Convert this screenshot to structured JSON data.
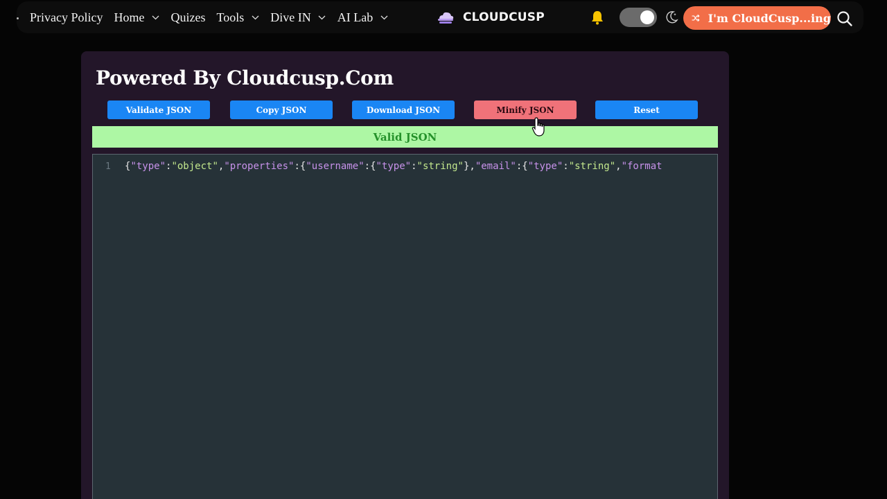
{
  "nav": {
    "items": [
      {
        "label": "Privacy Policy",
        "has_dropdown": false
      },
      {
        "label": "Home",
        "has_dropdown": true
      },
      {
        "label": "Quizes",
        "has_dropdown": false
      },
      {
        "label": "Tools",
        "has_dropdown": true
      },
      {
        "label": "Dive IN",
        "has_dropdown": true
      },
      {
        "label": "AI Lab",
        "has_dropdown": true
      }
    ],
    "brand": "CLOUDCUSP",
    "cta_label": "I'm CloudCusp...ing",
    "icons": [
      "cloud-logo-icon",
      "bell-icon",
      "theme-toggle",
      "moon-icon",
      "shuffle-icon",
      "search-icon"
    ],
    "theme_dark": true
  },
  "page": {
    "title": "Powered By Cloudcusp.Com"
  },
  "toolbar": {
    "validate_label": "Validate JSON",
    "copy_label": "Copy JSON",
    "download_label": "Download JSON",
    "minify_label": "Minify JSON",
    "reset_label": "Reset"
  },
  "status": {
    "text": "Valid JSON",
    "color": "#25912a",
    "background": "#adf7a4"
  },
  "editor": {
    "line_number": "1",
    "tokens": [
      {
        "t": "pun",
        "v": "{"
      },
      {
        "t": "key",
        "v": "\"type\""
      },
      {
        "t": "pun",
        "v": ":"
      },
      {
        "t": "str",
        "v": "\"object\""
      },
      {
        "t": "pun",
        "v": ","
      },
      {
        "t": "key",
        "v": "\"properties\""
      },
      {
        "t": "pun",
        "v": ":{"
      },
      {
        "t": "key",
        "v": "\"username\""
      },
      {
        "t": "pun",
        "v": ":{"
      },
      {
        "t": "key",
        "v": "\"type\""
      },
      {
        "t": "pun",
        "v": ":"
      },
      {
        "t": "str",
        "v": "\"string\""
      },
      {
        "t": "pun",
        "v": "},"
      },
      {
        "t": "key",
        "v": "\"email\""
      },
      {
        "t": "pun",
        "v": ":{"
      },
      {
        "t": "key",
        "v": "\"type\""
      },
      {
        "t": "pun",
        "v": ":"
      },
      {
        "t": "str",
        "v": "\"string\""
      },
      {
        "t": "pun",
        "v": ","
      },
      {
        "t": "key",
        "v": "\"format"
      }
    ]
  },
  "colors": {
    "accent_blue": "#1a86f4",
    "minify_red": "#f07279",
    "cta_orange": "#f26e48",
    "card_bg": "#231629",
    "editor_bg": "#263238"
  }
}
